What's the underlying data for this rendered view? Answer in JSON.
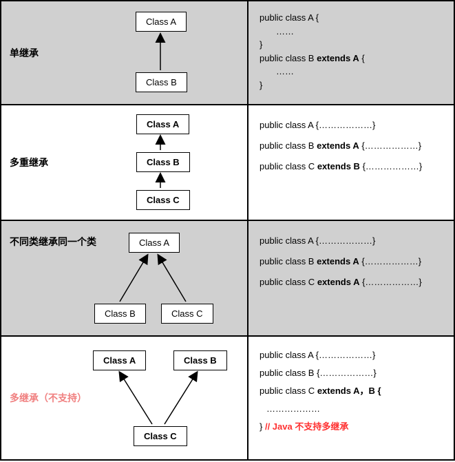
{
  "rows": [
    {
      "label": "单继承",
      "classes": {
        "a": "Class A",
        "b": "Class B"
      },
      "code": {
        "l1": "public class A {",
        "l2": "……",
        "l3": "}",
        "l4_pre": "public class B ",
        "l4_ext": "extends A",
        "l4_post": " {",
        "l5": "……",
        "l6": "}"
      }
    },
    {
      "label": "多重继承",
      "classes": {
        "a": "Class A",
        "b": "Class B",
        "c": "Class C"
      },
      "code": {
        "l1": "public class A {………………}",
        "l2_pre": "public class B ",
        "l2_ext": "extends A",
        "l2_post": " {………………}",
        "l3_pre": "public class C ",
        "l3_ext": "extends B",
        "l3_post": " {………………}"
      }
    },
    {
      "label": "不同类继承同一个类",
      "classes": {
        "a": "Class A",
        "b": "Class B",
        "c": "Class C"
      },
      "code": {
        "l1": "public class A {………………}",
        "l2_pre": "public class B ",
        "l2_ext": "extends A",
        "l2_post": " {………………}",
        "l3_pre": "public class C ",
        "l3_ext": "extends A",
        "l3_post": " {………………}"
      }
    },
    {
      "label": "多继承（不支持）",
      "classes": {
        "a": "Class A",
        "b": "Class B",
        "c": "Class C"
      },
      "code": {
        "l1": "public class A {………………}",
        "l2": "public class B {………………}",
        "l3_pre": "public class C ",
        "l3_ext": "extends A，B {",
        "l4": "………………",
        "l5_pre": "} ",
        "l5_red": "// Java 不支持多继承"
      }
    }
  ]
}
